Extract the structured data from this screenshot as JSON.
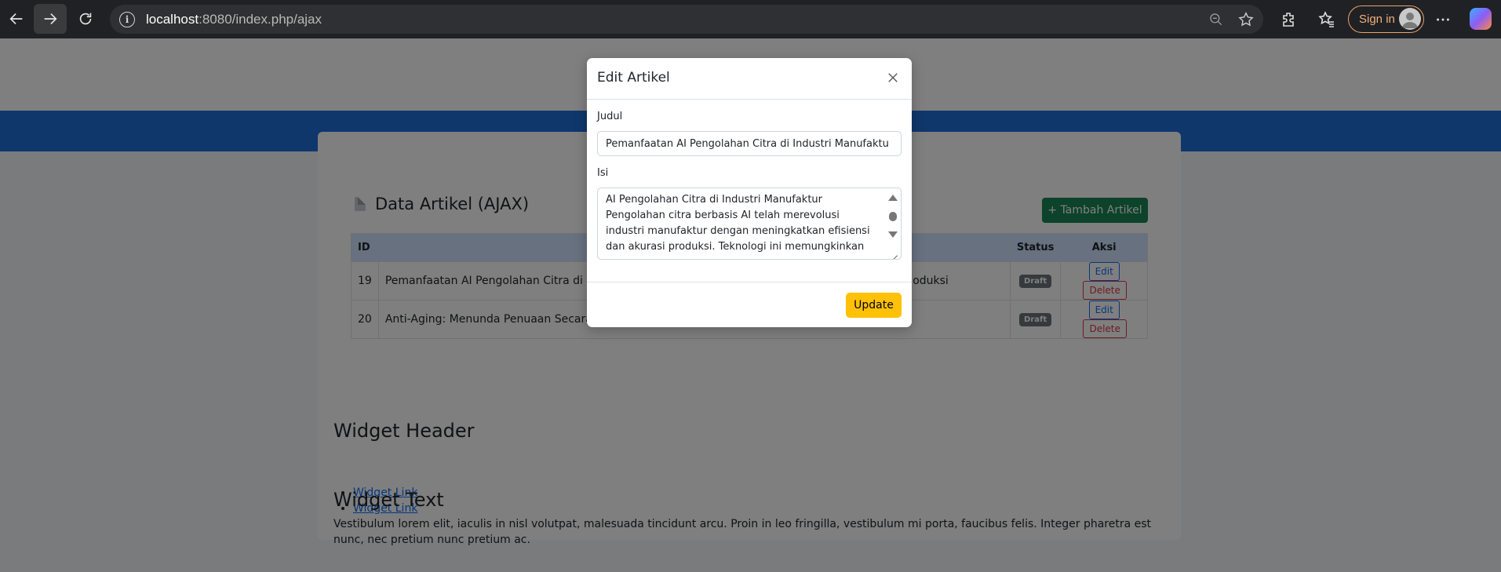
{
  "browser": {
    "url_host": "localhost",
    "url_rest": ":8080/index.php/ajax",
    "signin_label": "Sign in"
  },
  "card": {
    "title": "Data Artikel (AJAX)",
    "add_button": "+ Tambah Artikel"
  },
  "table": {
    "headers": {
      "id": "ID",
      "title": "",
      "status": "Status",
      "action": "Aksi"
    },
    "rows": [
      {
        "id": "19",
        "title": "Pemanfaatan AI Pengolahan Citra di In",
        "title_tail": "oduksi",
        "status": "Draft",
        "edit": "Edit",
        "delete": "Delete"
      },
      {
        "id": "20",
        "title": "Anti-Aging: Menunda Penuaan Secara Alami dan Efektif",
        "title_tail": "",
        "status": "Draft",
        "edit": "Edit",
        "delete": "Delete"
      }
    ]
  },
  "widgets": {
    "header_title": "Widget Header",
    "links": [
      "Widget Link",
      "Widget Link"
    ],
    "text_title": "Widget Text",
    "text_body": "Vestibulum lorem elit, iaculis in nisl volutpat, malesuada tincidunt arcu. Proin in leo fringilla, vestibulum mi porta, faucibus felis. Integer pharetra est nunc, nec pretium nunc pretium ac."
  },
  "modal": {
    "title": "Edit Artikel",
    "judul_label": "Judul",
    "judul_value": "Pemanfaatan AI Pengolahan Citra di Industri Manufaktu",
    "isi_label": "Isi",
    "isi_value": "AI Pengolahan Citra di Industri Manufaktur\nPengolahan citra berbasis AI telah merevolusi industri manufaktur dengan meningkatkan efisiensi dan akurasi produksi. Teknologi ini memungkinkan",
    "update_button": "Update"
  },
  "colors": {
    "blue_bar": "#1f6fd8",
    "add_button": "#198754",
    "update_button": "#ffc107",
    "table_header": "#cfe2ff"
  }
}
